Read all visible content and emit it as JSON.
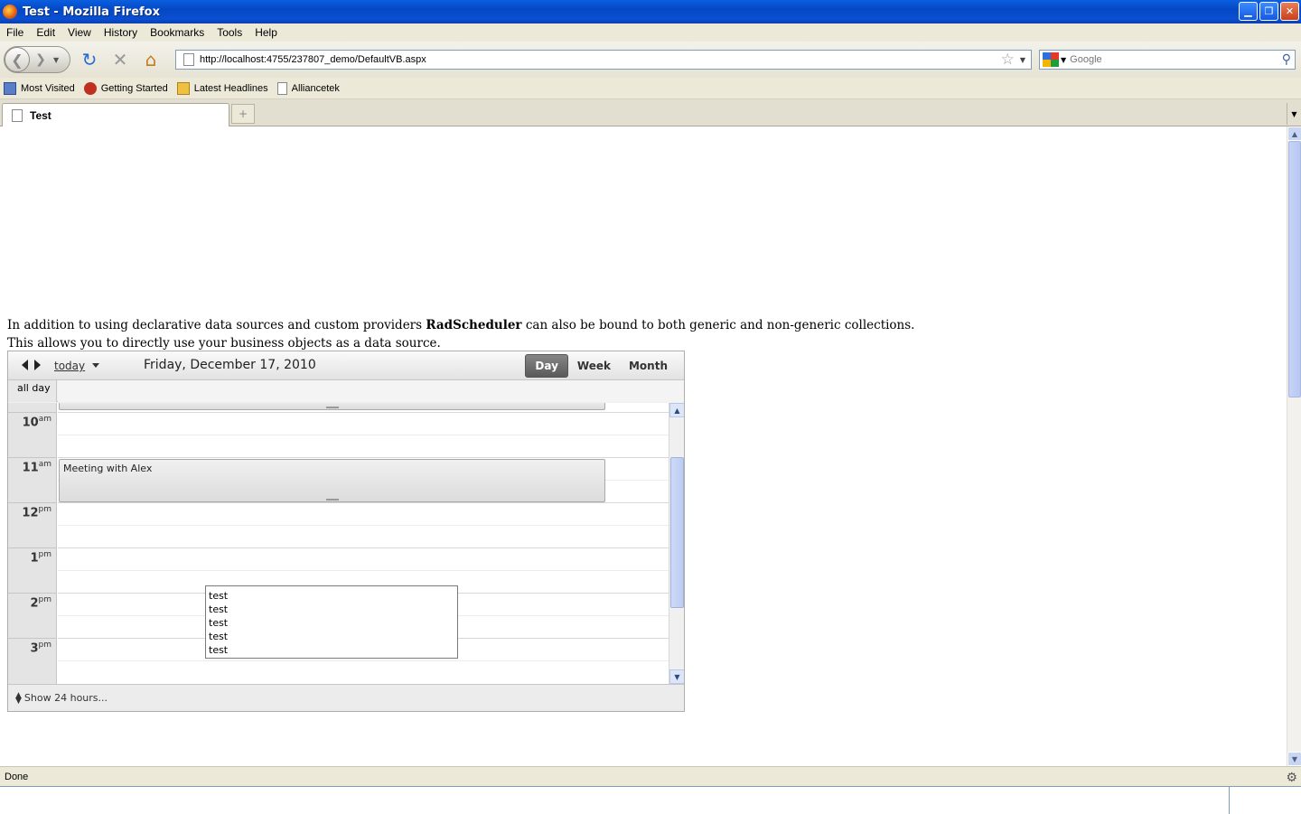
{
  "window": {
    "title": "Test - Mozilla Firefox"
  },
  "menu": [
    "File",
    "Edit",
    "View",
    "History",
    "Bookmarks",
    "Tools",
    "Help"
  ],
  "nav": {
    "url": "http://localhost:4755/237807_demo/DefaultVB.aspx",
    "search_placeholder": "Google"
  },
  "bookmarks": [
    "Most Visited",
    "Getting Started",
    "Latest Headlines",
    "Alliancetek"
  ],
  "tab": {
    "title": "Test",
    "new_tab": "+"
  },
  "intro": {
    "line1_pre": "In addition to using declarative data sources and custom providers ",
    "line1_bold": "RadScheduler",
    "line1_post": " can also be bound to both generic and non-generic collections.",
    "line2": "This allows you to directly use your business objects as a data source."
  },
  "scheduler": {
    "today": "today",
    "date": "Friday, December 17, 2010",
    "views": [
      "Day",
      "Week",
      "Month"
    ],
    "active_view": "Day",
    "all_day": "all day",
    "hours": [
      {
        "h": "10",
        "ampm": "am"
      },
      {
        "h": "11",
        "ampm": "am"
      },
      {
        "h": "12",
        "ampm": "pm"
      },
      {
        "h": "1",
        "ampm": "pm"
      },
      {
        "h": "2",
        "ampm": "pm"
      },
      {
        "h": "3",
        "ampm": "pm"
      }
    ],
    "appointment": "Meeting with Alex",
    "popup_items": [
      "test",
      "test",
      "test",
      "test",
      "test"
    ],
    "footer": "Show 24 hours..."
  },
  "status": {
    "text": "Done"
  }
}
